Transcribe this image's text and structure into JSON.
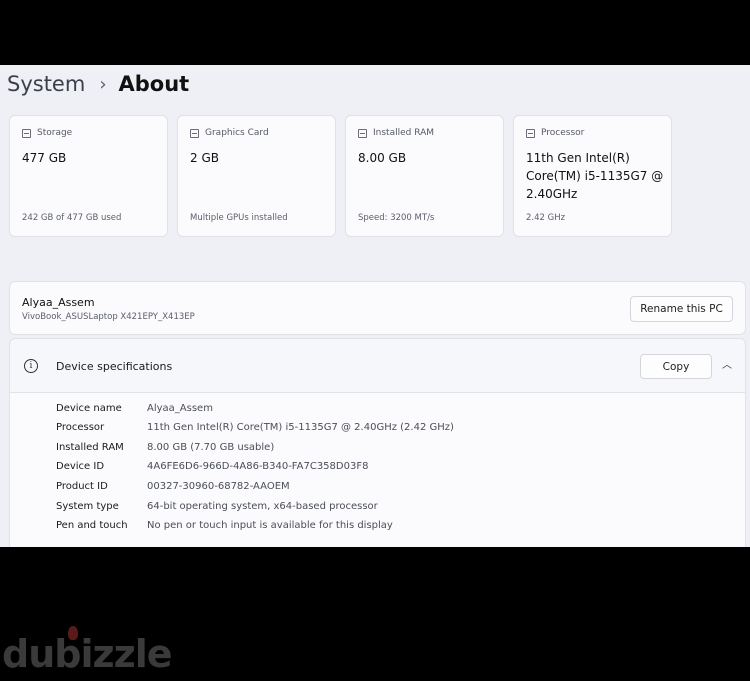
{
  "breadcrumb": {
    "parent": "System",
    "separator": "›",
    "current": "About"
  },
  "cards": [
    {
      "label": "Storage",
      "value": "477 GB",
      "foot": "242 GB of 477 GB used"
    },
    {
      "label": "Graphics Card",
      "value": "2 GB",
      "foot": "Multiple GPUs installed"
    },
    {
      "label": "Installed RAM",
      "value": "8.00 GB",
      "foot": "Speed: 3200 MT/s"
    },
    {
      "label": "Processor",
      "value": "11th Gen Intel(R) Core(TM) i5-1135G7 @ 2.40GHz",
      "foot": "2.42 GHz"
    }
  ],
  "pc": {
    "name": "Alyaa_Assem",
    "model": "VivoBook_ASUSLaptop X421EPY_X413EP",
    "rename_label": "Rename this PC"
  },
  "specs": {
    "title": "Device specifications",
    "copy_label": "Copy",
    "chevron": "︿",
    "rows": [
      {
        "key": "Device name",
        "value": "Alyaa_Assem"
      },
      {
        "key": "Processor",
        "value": "11th Gen Intel(R) Core(TM) i5-1135G7 @ 2.40GHz (2.42 GHz)"
      },
      {
        "key": "Installed RAM",
        "value": "8.00 GB (7.70 GB usable)"
      },
      {
        "key": "Device ID",
        "value": "4A6FE6D6-966D-4A86-B340-FA7C358D03F8"
      },
      {
        "key": "Product ID",
        "value": "00327-30960-68782-AAOEM"
      },
      {
        "key": "System type",
        "value": "64-bit operating system, x64-based processor"
      },
      {
        "key": "Pen and touch",
        "value": "No pen or touch input is available for this display"
      }
    ]
  },
  "watermark": {
    "text": "dubizzle"
  }
}
